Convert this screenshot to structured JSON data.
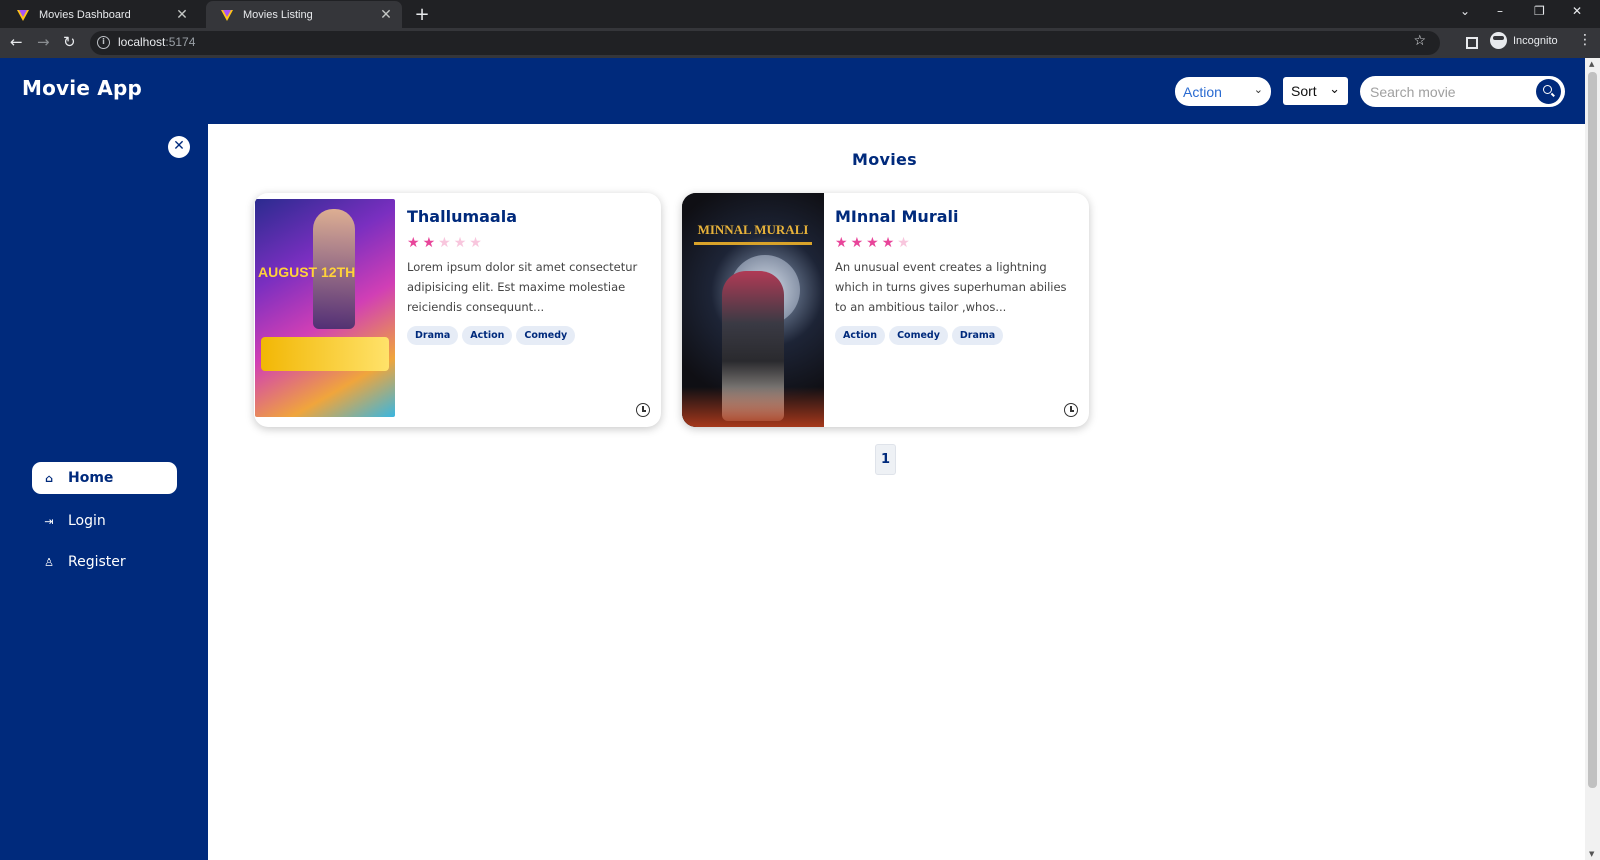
{
  "browser": {
    "tabs": [
      {
        "title": "Movies Dashboard",
        "active": false
      },
      {
        "title": "Movies Listing",
        "active": true
      }
    ],
    "url_host": "localhost",
    "url_port": ":5174",
    "profile_label": "Incognito"
  },
  "header": {
    "logo": "Movie App",
    "genre_select_value": "Action",
    "sort_label": "Sort",
    "search_placeholder": "Search movie"
  },
  "sidebar": {
    "items": [
      {
        "label": "Home",
        "icon": "home-icon",
        "active": true
      },
      {
        "label": "Login",
        "icon": "login-icon",
        "active": false
      },
      {
        "label": "Register",
        "icon": "user-icon",
        "active": false
      }
    ]
  },
  "main": {
    "title": "Movies",
    "movies": [
      {
        "title": "Thallumaala",
        "rating": 2,
        "rating_max": 5,
        "description": "Lorem ipsum dolor sit amet consectetur adipisicing elit. Est maxime molestiae reiciendis consequunt...",
        "tags": [
          "Drama",
          "Action",
          "Comedy"
        ],
        "poster_text": "AUGUST 12TH"
      },
      {
        "title": "MInnal Murali",
        "rating": 4,
        "rating_max": 5,
        "description": "An unusual event creates a lightning which in turns gives superhuman abilies to an ambitious tailor ,whos...",
        "tags": [
          "Action",
          "Comedy",
          "Drama"
        ],
        "poster_text": "MINNAL MURALI"
      }
    ],
    "pagination": {
      "current": "1"
    }
  },
  "colors": {
    "brand": "#002a7c",
    "star_on": "#e8459a",
    "star_off": "#f8c6dd"
  }
}
